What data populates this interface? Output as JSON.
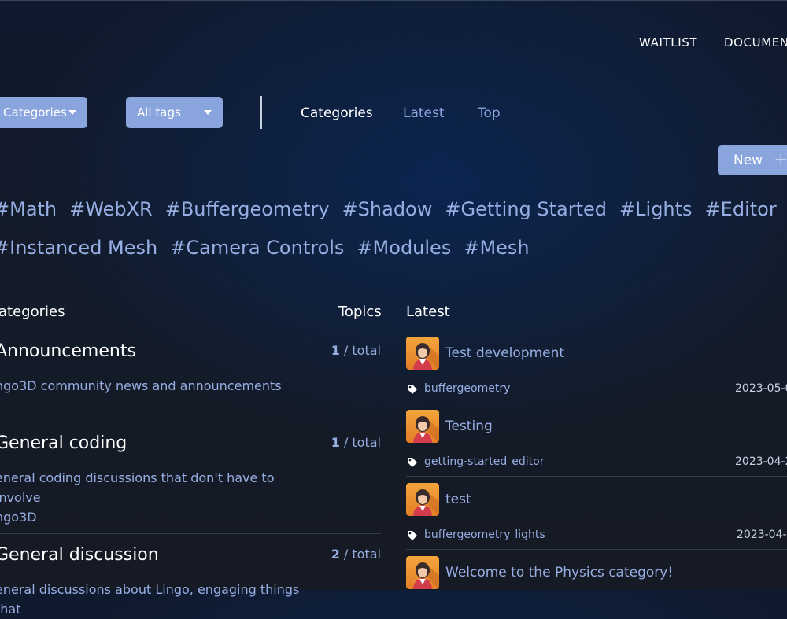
{
  "header": {
    "nav": [
      "WAITLIST",
      "DOCUMENT"
    ]
  },
  "filters": {
    "categories_dropdown": "Categories",
    "tags_dropdown": "All tags"
  },
  "tabs": [
    "Categories",
    "Latest",
    "Top"
  ],
  "active_tab": "Categories",
  "new_button": {
    "label": "New",
    "icon": "plus-icon"
  },
  "tag_rows": [
    [
      "#Math",
      "#WebXR",
      "#Buffergeometry",
      "#Shadow",
      "#Getting Started",
      "#Lights",
      "#Editor"
    ],
    [
      "#Instanced Mesh",
      "#Camera Controls",
      "#Modules",
      "#Mesh"
    ]
  ],
  "categories_table": {
    "col_category": "ategories",
    "col_topics": "Topics",
    "rows": [
      {
        "title": "Announcements",
        "desc": "ngo3D community news and announcements",
        "count": "1",
        "count_suffix": " / total"
      },
      {
        "title": "General coding",
        "desc": "eneral coding discussions that don't have to involve\nngo3D",
        "count": "1",
        "count_suffix": " / total"
      },
      {
        "title": "General discussion",
        "desc": "eneral discussions about Lingo, engaging things that",
        "count": "2",
        "count_suffix": " / total"
      }
    ]
  },
  "latest": {
    "heading": "Latest",
    "topics": [
      {
        "title": "Test development",
        "tags": [
          "buffergeometry"
        ],
        "date": "2023-05-0"
      },
      {
        "title": "Testing",
        "tags": [
          "getting-started",
          "editor"
        ],
        "date": "2023-04-2"
      },
      {
        "title": "test",
        "tags": [
          "buffergeometry",
          "lights"
        ],
        "date": "2023-04-1"
      },
      {
        "title": "Welcome to the Physics category!",
        "tags": [],
        "date": ""
      }
    ]
  },
  "colors": {
    "accent": "#8aa4dd",
    "link": "#97aee3",
    "background": "#141b28",
    "avatar_bg": "#ef9838"
  }
}
